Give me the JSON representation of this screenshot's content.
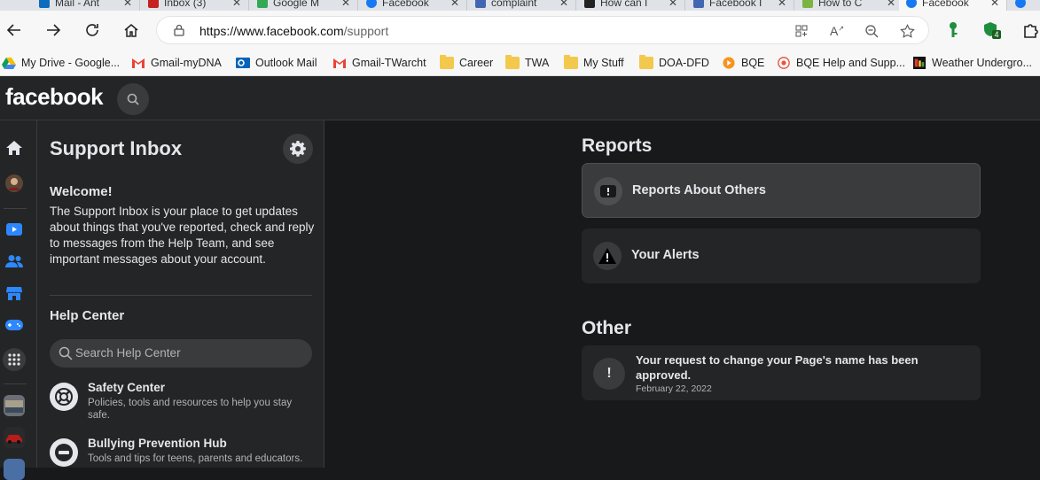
{
  "browser": {
    "tabs": [
      {
        "label": "Mail - Ant",
        "color": "#0f6cbd"
      },
      {
        "label": "Inbox (3)",
        "color": "#c5221f"
      },
      {
        "label": "Google M",
        "color": "#34a853"
      },
      {
        "label": "Facebook",
        "color": "#1877f2"
      },
      {
        "label": "complaint",
        "color": "#4267b2"
      },
      {
        "label": "How can I",
        "color": "#222222"
      },
      {
        "label": "Facebook I",
        "color": "#4267b2"
      },
      {
        "label": "How to C",
        "color": "#7cb342"
      },
      {
        "label": "Facebook",
        "color": "#1877f2"
      },
      {
        "label": "",
        "color": "#1877f2"
      }
    ],
    "url_host": "https://www.facebook.com",
    "url_path": "/support",
    "extension_badge": "4",
    "bookmarks": [
      {
        "label": "My Drive - Google...",
        "icon": "google-drive-icon"
      },
      {
        "label": "Gmail-myDNA",
        "icon": "gmail-icon"
      },
      {
        "label": "Outlook Mail",
        "icon": "outlook-icon"
      },
      {
        "label": "Gmail-TWarcht",
        "icon": "gmail-icon"
      },
      {
        "label": "Career",
        "icon": "folder-icon"
      },
      {
        "label": "TWA",
        "icon": "folder-icon"
      },
      {
        "label": "My Stuff",
        "icon": "folder-icon"
      },
      {
        "label": "DOA-DFD",
        "icon": "folder-icon"
      },
      {
        "label": "BQE",
        "icon": "bqe-icon"
      },
      {
        "label": "BQE Help and Supp...",
        "icon": "bqe-help-icon"
      },
      {
        "label": "Weather Undergro...",
        "icon": "weather-icon"
      }
    ]
  },
  "fb": {
    "logo": "facebook"
  },
  "sidebar": {
    "title": "Support Inbox",
    "welcome_title": "Welcome!",
    "welcome_text": "The Support Inbox is your place to get updates about things that you've reported, check and reply to messages from the Help Team, and see important messages about your account.",
    "help_center_title": "Help Center",
    "search_placeholder": "Search Help Center",
    "items": [
      {
        "title": "Safety Center",
        "desc": "Policies, tools and resources to help you stay safe."
      },
      {
        "title": "Bullying Prevention Hub",
        "desc": "Tools and tips for teens, parents and educators."
      }
    ]
  },
  "main": {
    "reports_title": "Reports",
    "reports": [
      {
        "label": "Reports About Others"
      },
      {
        "label": "Your Alerts"
      }
    ],
    "other_title": "Other",
    "other_items": [
      {
        "message": "Your request to change your Page's name has been approved.",
        "date": "February 22, 2022"
      }
    ]
  }
}
